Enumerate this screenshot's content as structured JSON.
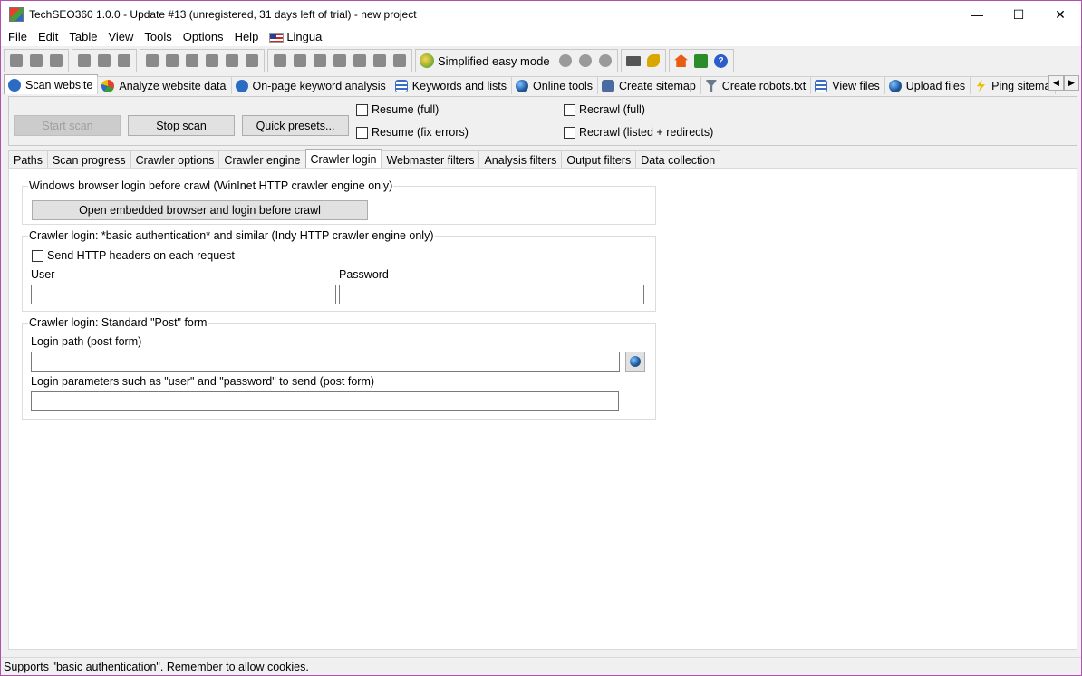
{
  "window": {
    "title": "TechSEO360 1.0.0 - Update #13 (unregistered, 31 days left of trial) - new project",
    "controls": [
      "—",
      "☐",
      "✕"
    ]
  },
  "menu": [
    "File",
    "Edit",
    "Table",
    "View",
    "Tools",
    "Options",
    "Help",
    "Lingua"
  ],
  "toolbar": {
    "easy_mode_label": "Simplified easy mode"
  },
  "main_tabs": [
    {
      "label": "Scan website",
      "icon": "magnifier-icon",
      "color": "#2a6cc4"
    },
    {
      "label": "Analyze website data",
      "icon": "pie-chart-icon",
      "color": "#e8a020"
    },
    {
      "label": "On-page keyword analysis",
      "icon": "magnifier-icon",
      "color": "#2a6cc4"
    },
    {
      "label": "Keywords and lists",
      "icon": "list-icon",
      "color": "#3a6cc4"
    },
    {
      "label": "Online tools",
      "icon": "globe-icon",
      "color": "#1d4f9a"
    },
    {
      "label": "Create sitemap",
      "icon": "sitemap-icon",
      "color": "#4a6aa0"
    },
    {
      "label": "Create robots.txt",
      "icon": "filter-icon",
      "color": "#6a7a8a"
    },
    {
      "label": "View files",
      "icon": "list-icon",
      "color": "#3a6cc4"
    },
    {
      "label": "Upload files",
      "icon": "upload-globe-icon",
      "color": "#1d4f9a"
    },
    {
      "label": "Ping sitema",
      "icon": "lightning-icon",
      "color": "#e8c000"
    }
  ],
  "scan": {
    "start_label": "Start scan",
    "stop_label": "Stop scan",
    "presets_label": "Quick presets...",
    "resume_full": "Resume (full)",
    "resume_fix": "Resume (fix errors)",
    "recrawl_full": "Recrawl (full)",
    "recrawl_listed": "Recrawl (listed + redirects)"
  },
  "sub_tabs": [
    "Paths",
    "Scan progress",
    "Crawler options",
    "Crawler engine",
    "Crawler login",
    "Webmaster filters",
    "Analysis filters",
    "Output filters",
    "Data collection"
  ],
  "active_sub_tab": "Crawler login",
  "login": {
    "group1_title": "Windows browser login before crawl (WinInet HTTP crawler engine only)",
    "open_browser_label": "Open embedded browser and login before crawl",
    "group2_title": "Crawler login: *basic authentication* and similar (Indy HTTP crawler engine only)",
    "send_headers_label": "Send HTTP headers on each request",
    "user_label": "User",
    "password_label": "Password",
    "user_value": "",
    "password_value": "",
    "group3_title": "Crawler login: Standard \"Post\" form",
    "login_path_label": "Login path (post form)",
    "login_path_value": "",
    "login_params_label": "Login parameters such as \"user\" and \"password\" to send (post form)",
    "login_params_value": ""
  },
  "status": "Supports \"basic authentication\". Remember to allow cookies."
}
